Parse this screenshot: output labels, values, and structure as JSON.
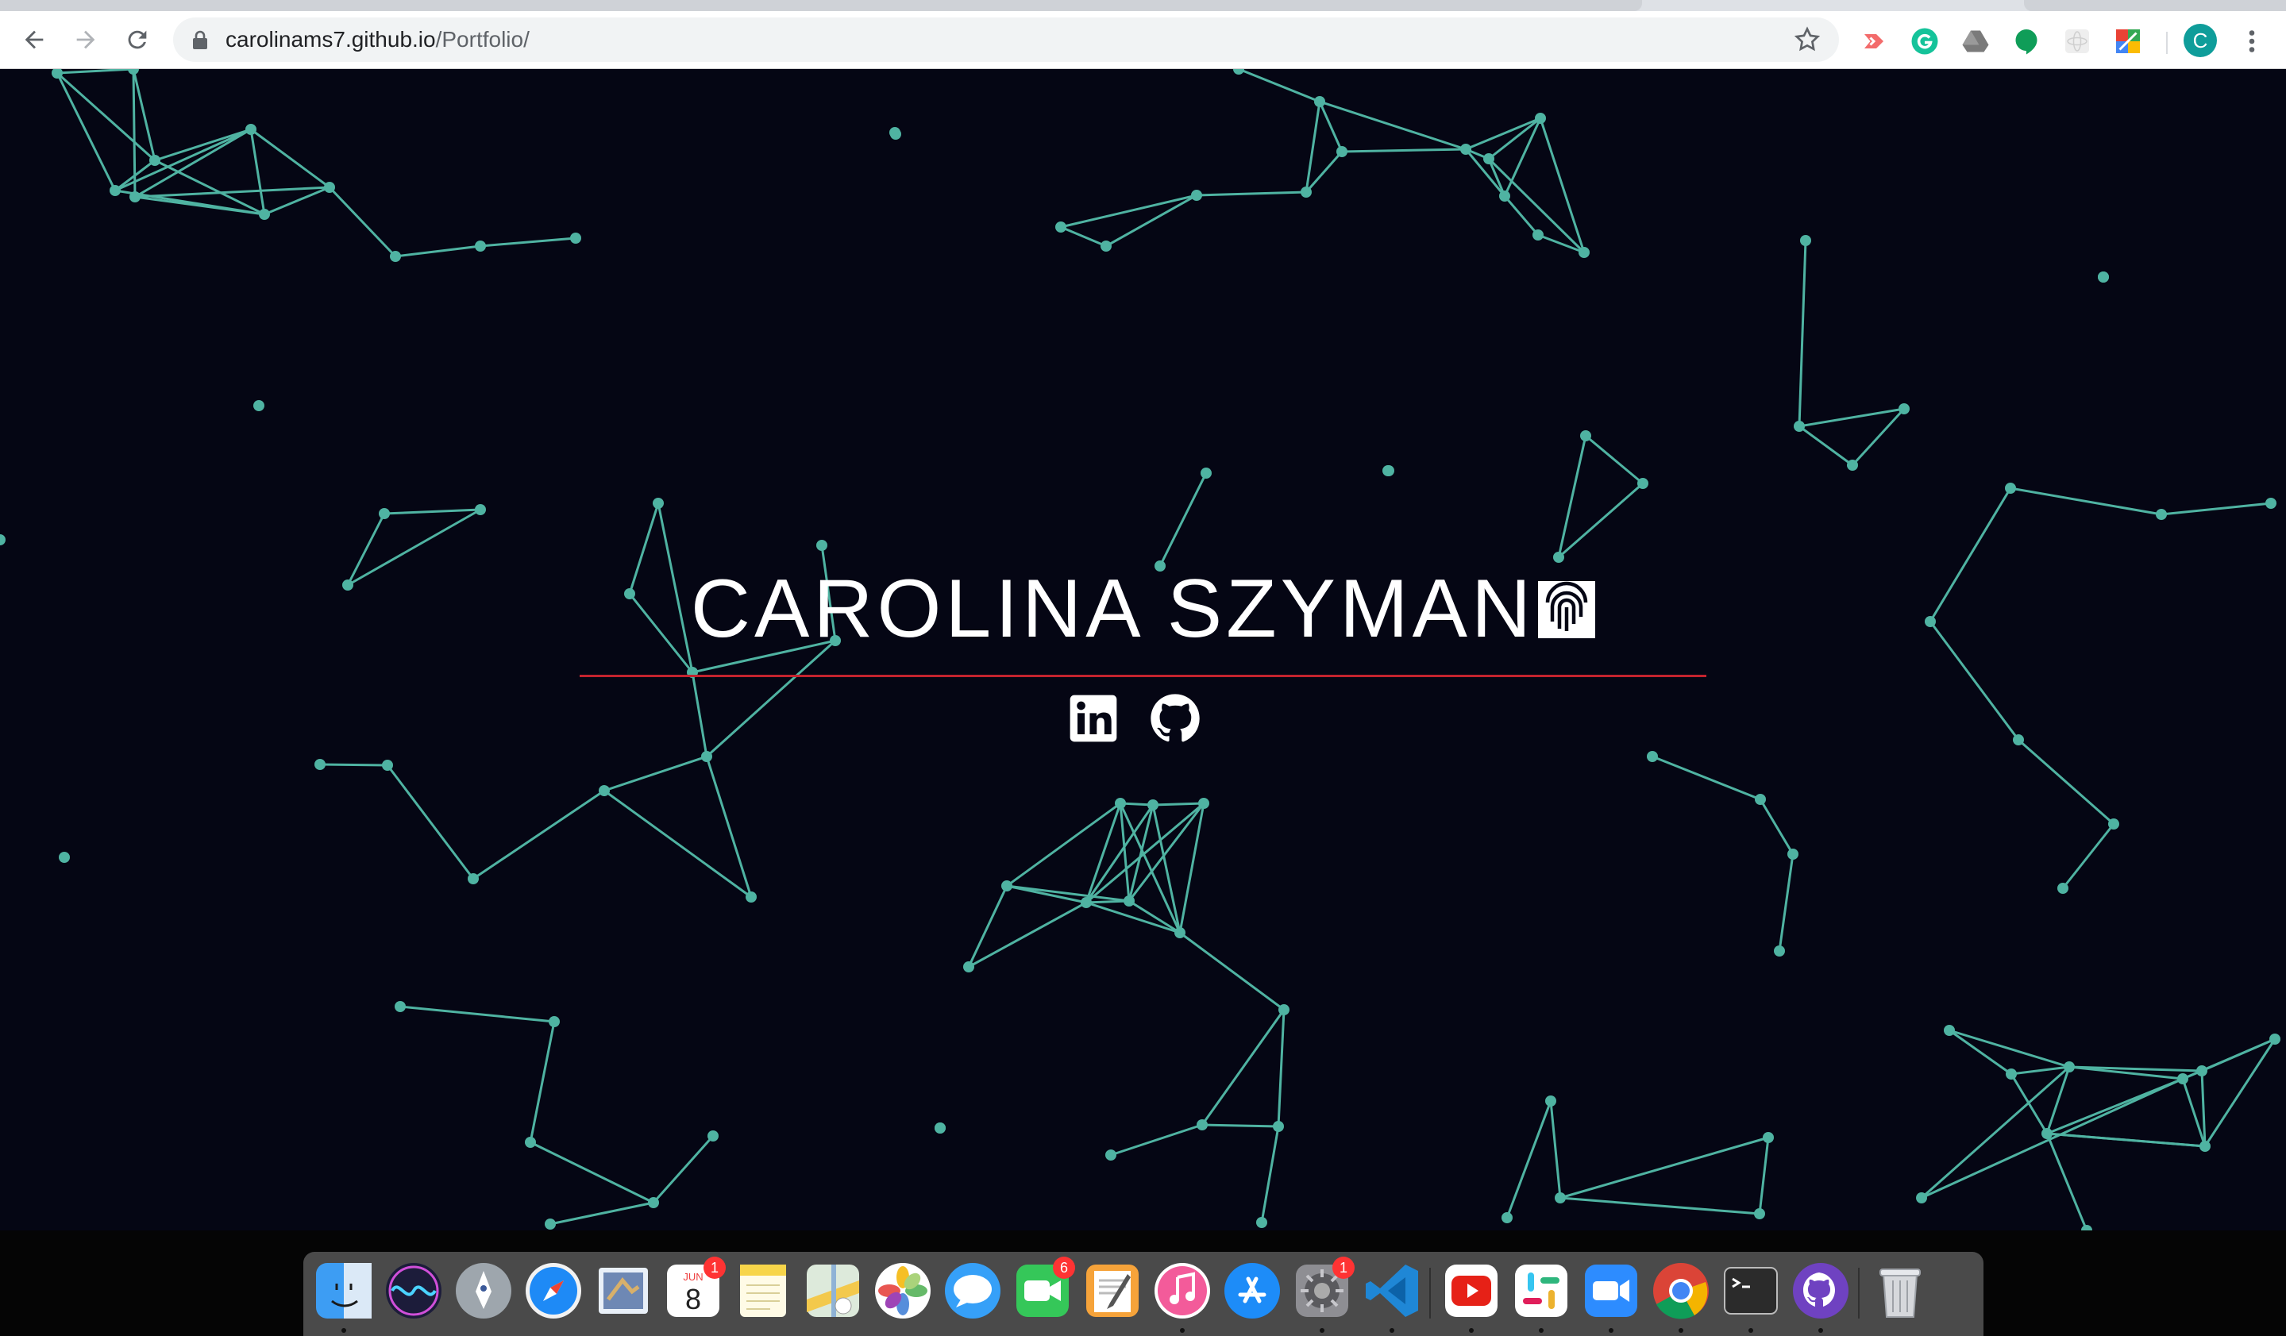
{
  "browser": {
    "url_domain": "carolinams7.github.io",
    "url_path": "/Portfolio/",
    "profile_initial": "C"
  },
  "page": {
    "title": "CAROLINA SZYMAN",
    "background_color": "#050614",
    "network_color": "#4fb3a2",
    "rule_color": "#c4232e",
    "social_links": [
      "linkedin-icon",
      "github-icon"
    ]
  },
  "dock": {
    "items": [
      {
        "name": "finder"
      },
      {
        "name": "siri"
      },
      {
        "name": "launchpad"
      },
      {
        "name": "safari"
      },
      {
        "name": "mail"
      },
      {
        "name": "calendar",
        "month": "JUN",
        "day": "8",
        "badge": "1"
      },
      {
        "name": "notes"
      },
      {
        "name": "maps"
      },
      {
        "name": "photos"
      },
      {
        "name": "messages"
      },
      {
        "name": "facetime",
        "badge": "6"
      },
      {
        "name": "pages"
      },
      {
        "name": "itunes"
      },
      {
        "name": "app-store"
      },
      {
        "name": "system-preferences",
        "badge": "1"
      },
      {
        "name": "vscode"
      },
      {
        "name": "youtube"
      },
      {
        "name": "slack"
      },
      {
        "name": "zoom"
      },
      {
        "name": "chrome"
      },
      {
        "name": "terminal"
      },
      {
        "name": "github-desktop"
      },
      {
        "name": "trash"
      }
    ]
  }
}
